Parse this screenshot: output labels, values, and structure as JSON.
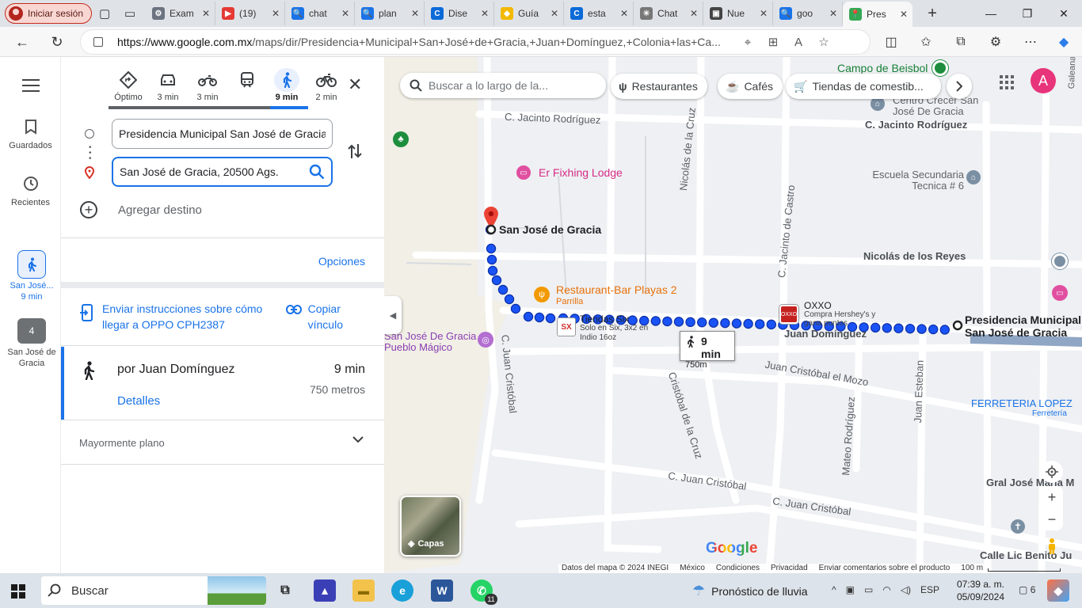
{
  "browser": {
    "profile_label": "Iniciar sesión",
    "tabs": [
      {
        "label": "Exam",
        "fav_color": "#6b7280",
        "fav_char": "⚙"
      },
      {
        "label": "(19)",
        "fav_color": "#e53935",
        "fav_char": "▶"
      },
      {
        "label": "chat",
        "fav_color": "#1a73e8",
        "fav_char": "🔍"
      },
      {
        "label": "plan",
        "fav_color": "#1a73e8",
        "fav_char": "🔍"
      },
      {
        "label": "Dise",
        "fav_color": "#0b6ad8",
        "fav_char": "C"
      },
      {
        "label": "Guía",
        "fav_color": "#f2b900",
        "fav_char": "◆"
      },
      {
        "label": "esta",
        "fav_color": "#0b6ad8",
        "fav_char": "C"
      },
      {
        "label": "Chat",
        "fav_color": "#777",
        "fav_char": "✳"
      },
      {
        "label": "Nue",
        "fav_color": "#444",
        "fav_char": "▣"
      },
      {
        "label": "goo",
        "fav_color": "#1a73e8",
        "fav_char": "🔍"
      },
      {
        "label": "Pres",
        "fav_color": "#34a853",
        "fav_char": "📍",
        "active": true
      }
    ],
    "url_domain": "https://www.google.com.mx",
    "url_path": "/maps/dir/Presidencia+Municipal+San+José+de+Gracia,+Juan+Domínguez,+Colonia+las+Ca..."
  },
  "rail": {
    "saved_label": "Guardados",
    "recent_label": "Recientes",
    "recent_walk_label": "San José...",
    "recent_walk_time": "9 min",
    "recent2_label": "San José de Gracia",
    "recent2_badge": "4"
  },
  "directions": {
    "modes": [
      {
        "name": "optimal",
        "label": "Óptimo"
      },
      {
        "name": "drive",
        "label": "3 min"
      },
      {
        "name": "motorcycle",
        "label": "3 min"
      },
      {
        "name": "transit",
        "label": ""
      },
      {
        "name": "walk",
        "label": "9 min",
        "active": true
      },
      {
        "name": "bike",
        "label": "2 min"
      }
    ],
    "origin": "Presidencia Municipal San José de Gracia",
    "destination": "San José de Gracia, 20500 Ags.",
    "add_destination": "Agregar destino",
    "options_label": "Opciones",
    "send_label": "Enviar instrucciones sobre cómo llegar a OPPO CPH2387",
    "copy_label": "Copiar vínculo",
    "route": {
      "name": "por Juan Domínguez",
      "time": "9 min",
      "distance": "750 metros",
      "details_label": "Detalles"
    },
    "terrain_label": "Mayormente plano"
  },
  "map": {
    "search_placeholder": "Buscar a lo largo de la...",
    "chips": [
      "Restaurantes",
      "Cafés",
      "Tiendas de comestib..."
    ],
    "user_initial": "A",
    "eta_time": "9 min",
    "eta_distance": "750m",
    "layers_label": "Capas",
    "labels": {
      "campo": "Campo de Beisbol",
      "centro_crecer": "Centro Crecer San José De Gracia",
      "jacinto_top_right": "C. Jacinto Rodríguez",
      "jacinto_top_left": "C. Jacinto Rodríguez",
      "escuela": "Escuela Secundaria Tecnica # 6",
      "lodge": "Er Fixhing Lodge",
      "nicolas_cruz": "Nicolás de la Cruz",
      "jacinto_castro": "C. Jacinto de Castro",
      "nicolas_reyes": "Nicolás de los Reyes",
      "restaurant": "Restaurant-Bar Playas 2",
      "restaurant_sub": "Parrilla",
      "oxxo": "OXXO",
      "oxxo_sub": "Compra Hershey's y gana puntos",
      "presidencia": "Presidencia Municipal San José de Gracia",
      "san_jose_pin": "San José de Gracia",
      "tiendas_six": "Tiendas Six",
      "tiendas_six_sub": "Solo en Six, 3x2 en Indio 16oz",
      "juan_dominguez": "Juan Domínguez",
      "pueblo_magico": "San José De Gracia Pueblo Mágico",
      "juan_cristobal_v": "C. Juan Cristóbal",
      "juan_cristobal_mozo": "Juan Cristóbal el Mozo",
      "cristobal_cruz": "Cristóbal de la Cruz",
      "juan_esteban": "Juan Esteban",
      "mateo": "Mateo Rodríguez",
      "ferreteria": "FERRETERIA LOPEZ",
      "ferreteria_sub": "Ferretería",
      "juan_cristobal_b1": "C. Juan Cristóbal",
      "juan_cristobal_b2": "C. Juan Cristóbal",
      "gral_jose": "Gral José María M",
      "calle_lic": "Calle Lic Benito Ju",
      "galeana": "Galeana"
    },
    "footer": [
      "Datos del mapa © 2024 INEGI",
      "México",
      "Condiciones",
      "Privacidad",
      "Enviar comentarios sobre el producto",
      "100 m"
    ],
    "google_logo": "Google"
  },
  "taskbar": {
    "search_label": "Buscar",
    "weather": "Pronóstico de lluvia",
    "lang": "ESP",
    "time": "07:39 a. m.",
    "date": "05/09/2024",
    "notif_count": "6",
    "whatsapp_badge": "11"
  }
}
